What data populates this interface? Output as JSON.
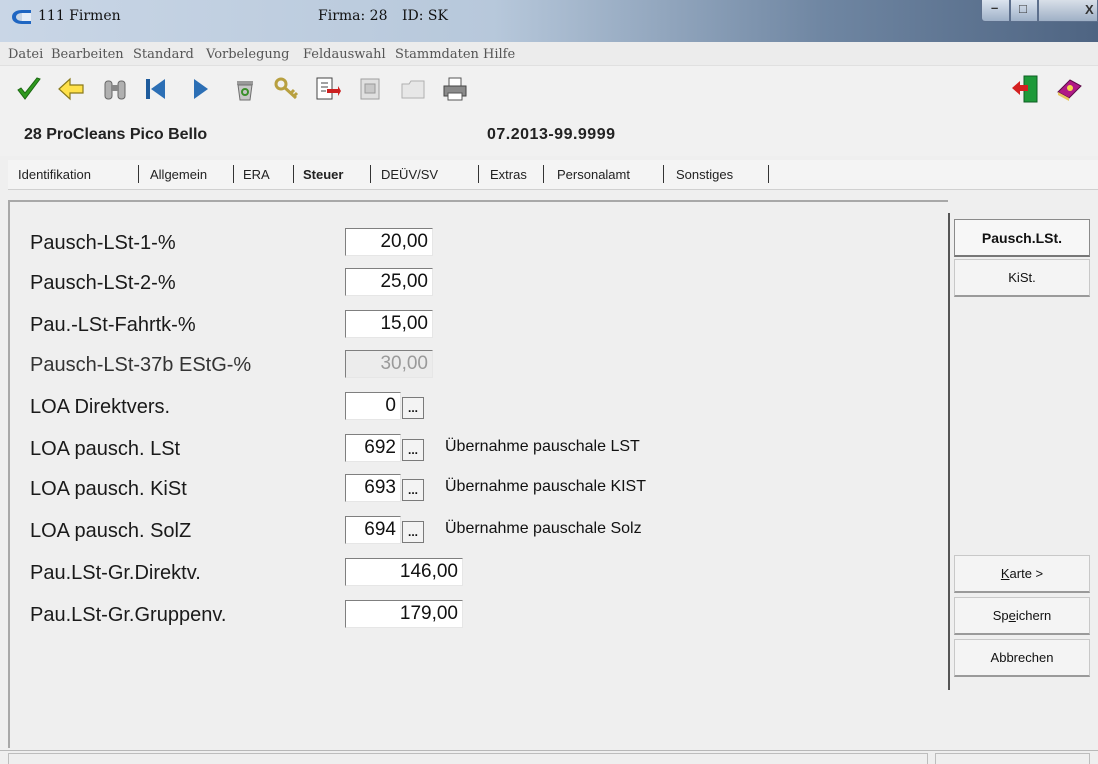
{
  "window": {
    "title": "111 Firmen",
    "firma_label": "Firma: 28",
    "id_label": "ID: SK",
    "minimize_label": "–",
    "maximize_label": "□",
    "close_label": "X"
  },
  "menu": [
    "Datei",
    "Bearbeiten",
    "Standard",
    "Vorbelegung",
    "Feldauswahl",
    "Stammdaten",
    "Hilfe"
  ],
  "toolbar": {
    "icons": [
      "check-icon",
      "back-arrow-icon",
      "binoculars-icon",
      "first-record-icon",
      "next-record-icon",
      "recycle-bin-icon",
      "key-icon",
      "export-icon",
      "form-icon",
      "folder-icon",
      "printer-icon",
      "exit-door-icon",
      "help-book-icon"
    ]
  },
  "company": {
    "name": "28 ProCleans Pico Bello",
    "period": "07.2013-99.9999"
  },
  "tabs": [
    {
      "label": "Identifikation",
      "active": false
    },
    {
      "label": "Allgemein",
      "active": false
    },
    {
      "label": "ERA",
      "active": false
    },
    {
      "label": "Steuer",
      "active": true
    },
    {
      "label": "DEÜV/SV",
      "active": false
    },
    {
      "label": "Extras",
      "active": false
    },
    {
      "label": "Personalamt",
      "active": false
    },
    {
      "label": "Sonstiges",
      "active": false
    }
  ],
  "fields": [
    {
      "label": "Pausch-LSt-1-%",
      "value": "20,00"
    },
    {
      "label": "Pausch-LSt-2-%",
      "value": "25,00"
    },
    {
      "label": "Pau.-LSt-Fahrtk-%",
      "value": "15,00"
    },
    {
      "label": "Pausch-LSt-37b EStG-%",
      "value": "30,00",
      "disabled": true
    },
    {
      "label": "LOA Direktvers.",
      "value": "0",
      "button": "..."
    },
    {
      "label": "LOA pausch. LSt",
      "value": "692",
      "button": "...",
      "description": "Übernahme pauschale LST"
    },
    {
      "label": "LOA pausch. KiSt",
      "value": "693",
      "button": "...",
      "description": "Übernahme pauschale KIST"
    },
    {
      "label": "LOA pausch. SolZ",
      "value": "694",
      "button": "...",
      "description": "Übernahme pauschale Solz"
    },
    {
      "label": "Pau.LSt-Gr.Direktv.",
      "value": "146,00"
    },
    {
      "label": "Pau.LSt-Gr.Gruppenv.",
      "value": "179,00"
    }
  ],
  "side_buttons": {
    "pausch_lst": "Pausch.LSt.",
    "kist": "KiSt.",
    "karte_k": "K",
    "karte_rest": "arte >",
    "speichern_a": "Sp",
    "speichern_e": "e",
    "speichern_b": "ichern",
    "abbrechen": "Abbrechen"
  }
}
